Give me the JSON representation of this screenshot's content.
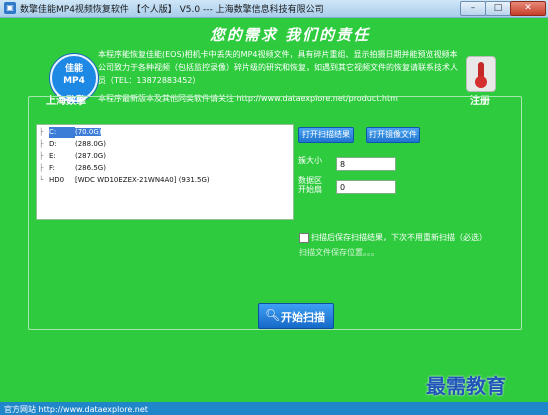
{
  "window": {
    "title": "数擎佳能MP4视频恢复软件 【个人版】 V5.0 --- 上海数擎信息科技有限公司",
    "minimize_glyph": "–",
    "maximize_glyph": "□",
    "close_glyph": "✕"
  },
  "header": {
    "slogan": "您的需求  我们的责任",
    "logo_text": "佳能\nMP4",
    "company": "上海数擎",
    "description": "本程序能恢复佳能(EOS)相机卡中丢失的MP4视频文件，具有碎片重组、显示拍摄日期并能预览视频本公司致力于各种视频（包括监控录像）碎片级的研究和恢复，如遇到其它视频文件的恢复请联系技术人员（TEL：13872883452）",
    "update_note": "本程序最新版本及其他同类软件请关注 http://www.dataexplore.net/product.htm",
    "register_label": "注册"
  },
  "tree": {
    "items": [
      {
        "conn": "├",
        "drive": "C:",
        "size": "(70.0G)",
        "selected": true
      },
      {
        "conn": "├",
        "drive": "D:",
        "size": "(288.0G)",
        "selected": false
      },
      {
        "conn": "├",
        "drive": "E:",
        "size": "(287.0G)",
        "selected": false
      },
      {
        "conn": "├",
        "drive": "F:",
        "size": "(286.5G)",
        "selected": false
      },
      {
        "conn": "└",
        "drive": "HD0",
        "size": "[WDC WD10EZEX-21WN4A0]  (931.5G)",
        "selected": false
      }
    ]
  },
  "actions": {
    "open_result": "打开扫描结果",
    "open_image": "打开镜像文件",
    "start_scan": "开始扫描"
  },
  "fields": {
    "size_label": "簇大小",
    "size_value": "8",
    "start_label": "数据区开始扇",
    "start_value": "0"
  },
  "options": {
    "save_result_label": "扫描后保存扫描结果，下次不用重新扫描（必选）",
    "save_result_checked": false,
    "save_position": "扫描文件保存位置。。。"
  },
  "watermark": "最需教育",
  "footer": {
    "text": "官方网站 http://www.dataexplore.net"
  }
}
